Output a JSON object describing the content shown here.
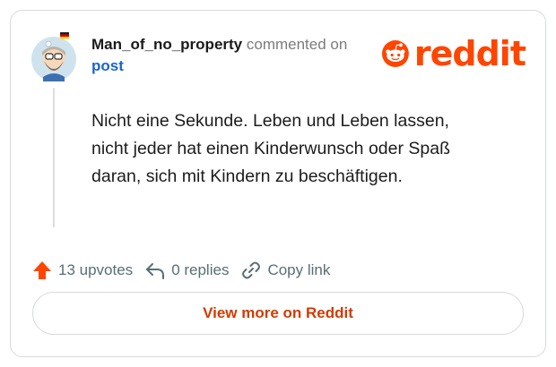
{
  "comment": {
    "username": "Man_of_no_property",
    "action_text": "commented on",
    "target_link": "post",
    "body_lines": [
      "Nicht eine Sekunde. Leben und Leben lassen,",
      "nicht jeder hat einen Kinderwunsch oder Spaß",
      "daran, sich mit Kindern zu beschäftigen."
    ]
  },
  "brand": {
    "logo_text": "reddit",
    "logo_icon": "snoo-icon",
    "accent_color": "#ff4500"
  },
  "actions": {
    "upvotes_label": "13 upvotes",
    "upvote_icon": "upvote-arrow-icon",
    "replies_label": "0 replies",
    "reply_icon": "reply-arrow-icon",
    "copy_link_label": "Copy link",
    "copy_link_icon": "link-icon"
  },
  "footer": {
    "view_more_label": "View more on Reddit"
  }
}
